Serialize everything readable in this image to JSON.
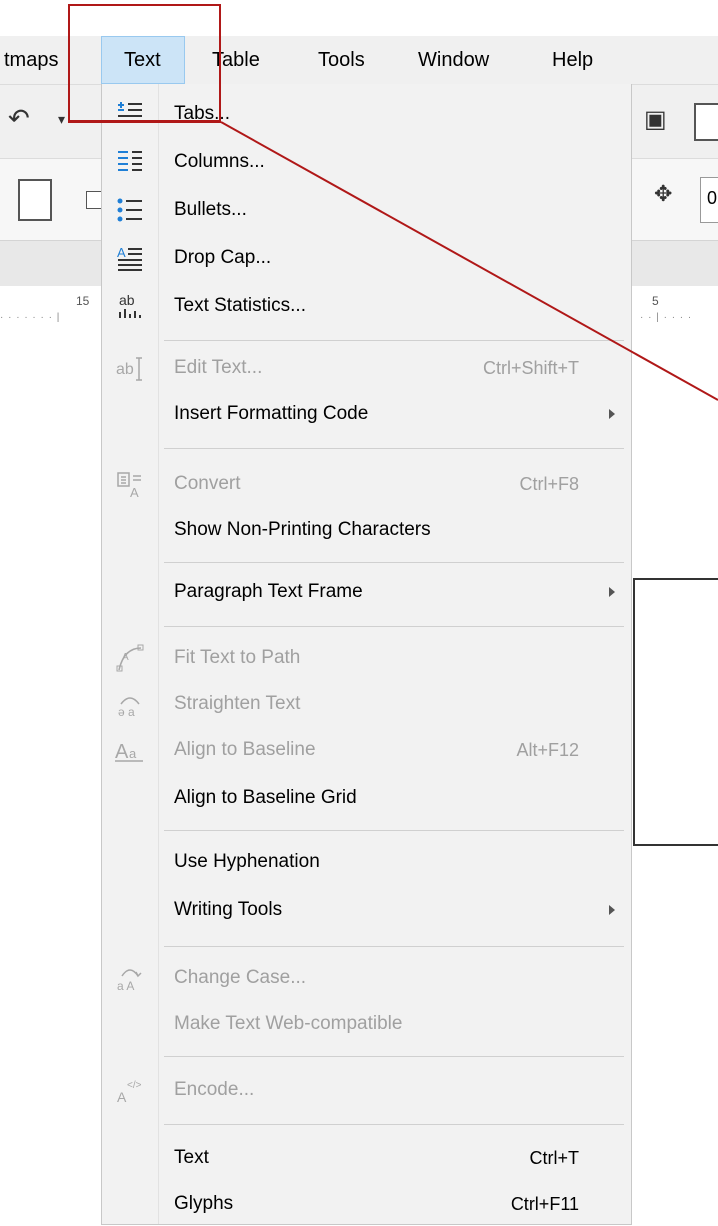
{
  "menubar": {
    "items": [
      {
        "label": "tmaps",
        "active": false
      },
      {
        "label": "Text",
        "active": true
      },
      {
        "label": "Table",
        "active": false
      },
      {
        "label": "Tools",
        "active": false
      },
      {
        "label": "Window",
        "active": false
      },
      {
        "label": "Help",
        "active": false
      }
    ]
  },
  "ruler": {
    "label_left": "15",
    "label_right": "5"
  },
  "toolbar": {
    "partial_value": "0"
  },
  "menu": {
    "items": [
      {
        "label": "Tabs...",
        "shortcut": "",
        "disabled": false,
        "submenu": false,
        "icon": "tabs-icon"
      },
      {
        "label": "Columns...",
        "shortcut": "",
        "disabled": false,
        "submenu": false,
        "icon": "columns-icon"
      },
      {
        "label": "Bullets...",
        "shortcut": "",
        "disabled": false,
        "submenu": false,
        "icon": "bullets-icon"
      },
      {
        "label": "Drop Cap...",
        "shortcut": "",
        "disabled": false,
        "submenu": false,
        "icon": "drop-cap-icon"
      },
      {
        "label": "Text Statistics...",
        "shortcut": "",
        "disabled": false,
        "submenu": false,
        "icon": "text-statistics-icon"
      },
      {
        "label": "Edit Text...",
        "shortcut": "Ctrl+Shift+T",
        "disabled": true,
        "submenu": false,
        "icon": "edit-text-icon"
      },
      {
        "label": "Insert Formatting Code",
        "shortcut": "",
        "disabled": false,
        "submenu": true,
        "icon": ""
      },
      {
        "label": "Convert",
        "shortcut": "Ctrl+F8",
        "disabled": true,
        "submenu": false,
        "icon": "convert-icon"
      },
      {
        "label": "Show Non-Printing Characters",
        "shortcut": "",
        "disabled": false,
        "submenu": false,
        "icon": ""
      },
      {
        "label": "Paragraph Text Frame",
        "shortcut": "",
        "disabled": false,
        "submenu": true,
        "icon": ""
      },
      {
        "label": "Fit Text to Path",
        "shortcut": "",
        "disabled": true,
        "submenu": false,
        "icon": "fit-text-to-path-icon"
      },
      {
        "label": "Straighten Text",
        "shortcut": "",
        "disabled": true,
        "submenu": false,
        "icon": "straighten-text-icon"
      },
      {
        "label": "Align to Baseline",
        "shortcut": "Alt+F12",
        "disabled": true,
        "submenu": false,
        "icon": "align-baseline-icon"
      },
      {
        "label": "Align to Baseline Grid",
        "shortcut": "",
        "disabled": false,
        "submenu": false,
        "icon": ""
      },
      {
        "label": "Use Hyphenation",
        "shortcut": "",
        "disabled": false,
        "submenu": false,
        "icon": ""
      },
      {
        "label": "Writing Tools",
        "shortcut": "",
        "disabled": false,
        "submenu": true,
        "icon": ""
      },
      {
        "label": "Change Case...",
        "shortcut": "",
        "disabled": true,
        "submenu": false,
        "icon": "change-case-icon"
      },
      {
        "label": "Make Text Web-compatible",
        "shortcut": "",
        "disabled": true,
        "submenu": false,
        "icon": ""
      },
      {
        "label": "Encode...",
        "shortcut": "",
        "disabled": true,
        "submenu": false,
        "icon": "encode-icon"
      },
      {
        "label": "Text",
        "shortcut": "Ctrl+T",
        "disabled": false,
        "submenu": false,
        "icon": ""
      },
      {
        "label": "Glyphs",
        "shortcut": "Ctrl+F11",
        "disabled": false,
        "submenu": false,
        "icon": ""
      }
    ]
  },
  "colors": {
    "menu_bg": "#f2f2f2",
    "disabled_text": "#a0a0a0",
    "annotation": "#b01818",
    "icon_blue": "#1f7fd6"
  }
}
